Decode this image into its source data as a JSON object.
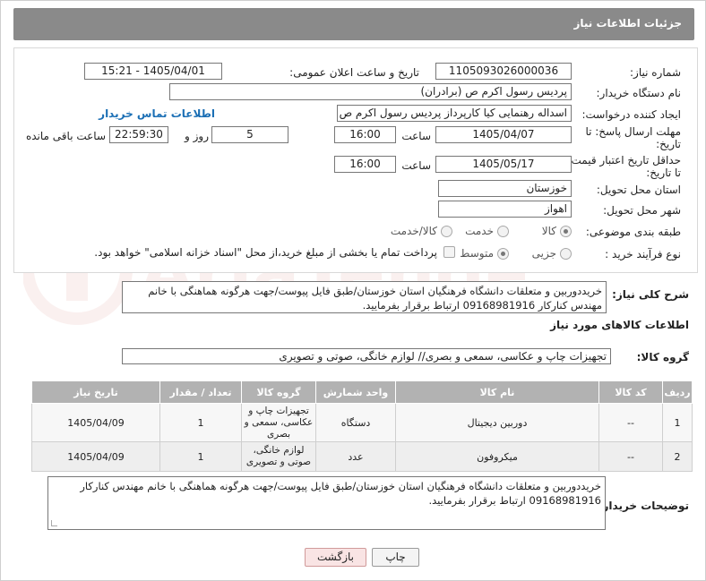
{
  "header": {
    "title": "جزئیات اطلاعات نیاز"
  },
  "form": {
    "need_number_label": "شماره نیاز:",
    "need_number": "1105093026000036",
    "announce_label": "تاریخ و ساعت اعلان عمومی:",
    "announce_value": "1405/04/01 - 15:21",
    "buyer_org_label": "نام دستگاه خریدار:",
    "buyer_org": "پردیس رسول اکرم ص (برادران)",
    "requester_label": "ایجاد کننده درخواست:",
    "requester": "اسداله رهنمایی کیا کارپرداز پردیس رسول اکرم ص (برادران)",
    "contact_link": "اطلاعات تماس خریدار",
    "deadline_label_1": "مهلت ارسال پاسخ: تا",
    "deadline_label_2": "تاریخ:",
    "deadline_date": "1405/04/07",
    "time_label": "ساعت",
    "deadline_time": "16:00",
    "days_value": "5",
    "days_label": "روز و",
    "remaining_time": "22:59:30",
    "remaining_label": "ساعت باقی مانده",
    "validity_label_1": "حداقل تاریخ اعتبار قیمت:",
    "validity_label_2": "تا تاریخ:",
    "validity_date": "1405/05/17",
    "validity_time": "16:00",
    "province_label": "استان محل تحویل:",
    "province": "خوزستان",
    "city_label": "شهر محل تحویل:",
    "city": "اهواز",
    "category_label": "طبقه بندی موضوعی:",
    "category_options": [
      "کالا",
      "خدمت",
      "کالا/خدمت"
    ],
    "category_selected": "کالا",
    "process_label": "نوع فرآیند خرید :",
    "process_options": [
      "جزیی",
      "متوسط"
    ],
    "process_selected": "متوسط",
    "payment_note": "پرداخت تمام یا بخشی از مبلغ خرید،از محل \"اسناد خزانه اسلامی\" خواهد بود."
  },
  "description": {
    "label": "شرح کلی نیاز:",
    "line1": "خریددوربین و متعلقات دانشگاه فرهنگیان استان خوزستان/طبق فایل پیوست/جهت هرگونه هماهنگی با خانم",
    "line2": "مهندس کنارکار 09168981916 ارتباط برقرار بفرمایید."
  },
  "goods": {
    "section_title": "اطلاعات کالاهای مورد نیاز",
    "group_label": "گروه کالا:",
    "group_value": "تجهیزات چاپ و عکاسی، سمعی و بصری// لوازم خانگی، صوتی و تصویری",
    "columns": [
      "ردیف",
      "کد کالا",
      "نام کالا",
      "واحد شمارش",
      "گروه کالا",
      "تعداد / مقدار",
      "تاریخ نیاز"
    ],
    "rows": [
      {
        "idx": "1",
        "code": "--",
        "name": "دوربین دیجیتال",
        "unit": "دستگاه",
        "group": "تجهیزات چاپ و عکاسی، سمعی و بصری",
        "qty": "1",
        "date": "1405/04/09"
      },
      {
        "idx": "2",
        "code": "--",
        "name": "میکروفون",
        "unit": "عدد",
        "group": "لوازم خانگی، صوتی و تصویری",
        "qty": "1",
        "date": "1405/04/09"
      }
    ]
  },
  "buyer_notes": {
    "label": "توضیحات خریدار:",
    "line1": "خریددوربین و متعلقات دانشگاه فرهنگیان استان خوزستان/طبق فایل پیوست/جهت هرگونه هماهنگی با خانم مهندس کنارکار",
    "line2": "09168981916 ارتباط برقرار بفرمایید."
  },
  "buttons": {
    "print": "چاپ",
    "back": "بازگشت"
  },
  "watermark": {
    "text": "AriaTender.neT"
  }
}
